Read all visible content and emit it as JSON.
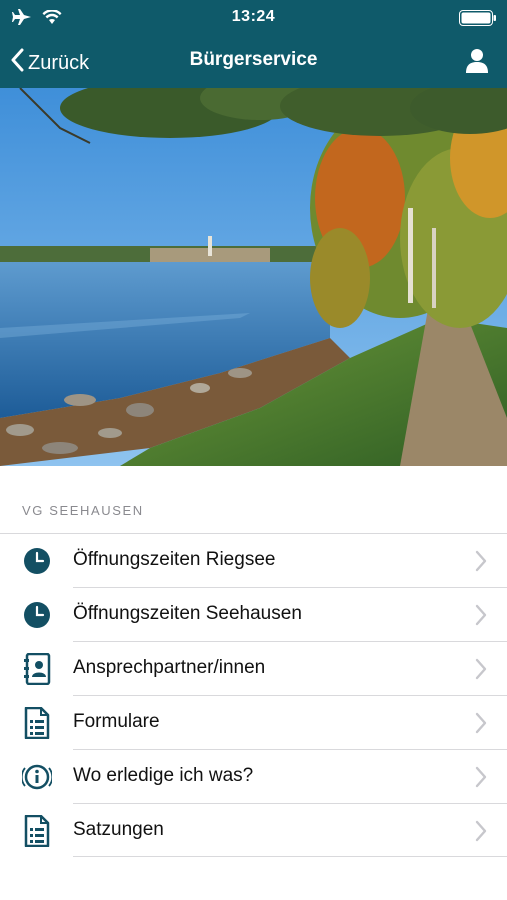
{
  "status_bar": {
    "time": "13:24",
    "icons": [
      "airplane-icon",
      "wifi-icon",
      "battery-icon"
    ]
  },
  "nav": {
    "back_label": "Zurück",
    "title": "Bürgerservice",
    "profile_icon": "user-icon"
  },
  "colors": {
    "bar": "#0f5a6a",
    "icon": "#134f63",
    "chevron": "#c7c7cc"
  },
  "section": {
    "header": "VG SEEHAUSEN",
    "items": [
      {
        "label": "Öffnungszeiten Riegsee",
        "icon": "clock-icon"
      },
      {
        "label": "Öffnungszeiten Seehausen",
        "icon": "clock-icon"
      },
      {
        "label": "Ansprechpartner/innen",
        "icon": "contacts-book-icon"
      },
      {
        "label": "Formulare",
        "icon": "document-icon"
      },
      {
        "label": "Wo erledige ich was?",
        "icon": "info-icon"
      },
      {
        "label": "Satzungen",
        "icon": "document-icon"
      }
    ]
  }
}
